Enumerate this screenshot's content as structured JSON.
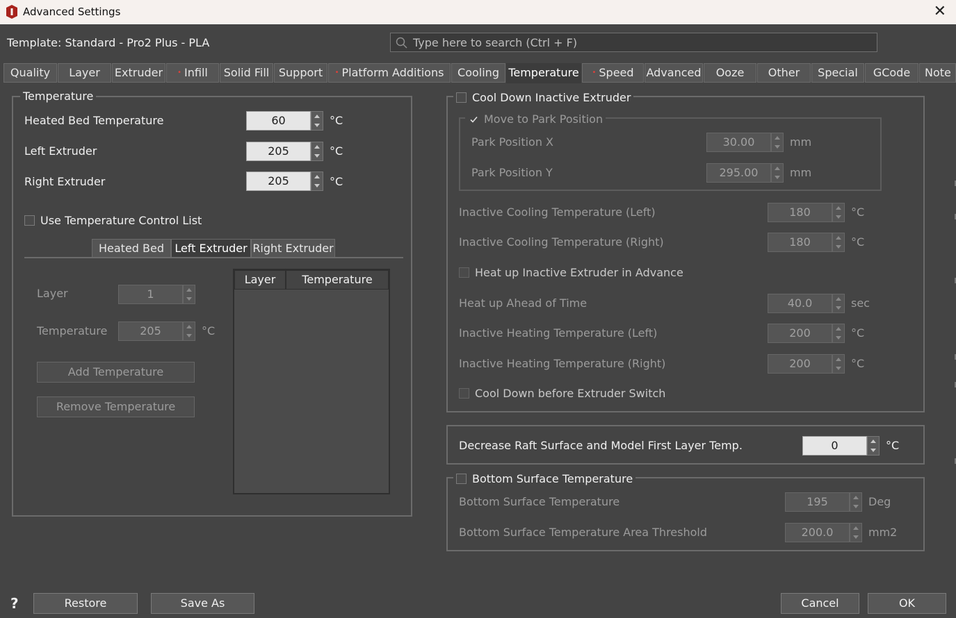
{
  "window": {
    "title": "Advanced Settings",
    "close_glyph": "✕",
    "icon": "app-logo-icon"
  },
  "template_label": "Template: Standard - Pro2 Plus - PLA",
  "search": {
    "placeholder": "Type here to search (Ctrl + F)",
    "value": ""
  },
  "tabs": [
    {
      "label": "Quality",
      "modified": false,
      "active": false
    },
    {
      "label": "Layer",
      "modified": false,
      "active": false
    },
    {
      "label": "Extruder",
      "modified": false,
      "active": false
    },
    {
      "label": "Infill",
      "modified": true,
      "active": false
    },
    {
      "label": "Solid Fill",
      "modified": false,
      "active": false
    },
    {
      "label": "Support",
      "modified": false,
      "active": false
    },
    {
      "label": "Platform Additions",
      "modified": true,
      "active": false
    },
    {
      "label": "Cooling",
      "modified": false,
      "active": false
    },
    {
      "label": "Temperature",
      "modified": false,
      "active": true
    },
    {
      "label": "Speed",
      "modified": true,
      "active": false
    },
    {
      "label": "Advanced",
      "modified": false,
      "active": false
    },
    {
      "label": "Ooze",
      "modified": false,
      "active": false
    },
    {
      "label": "Other",
      "modified": false,
      "active": false
    },
    {
      "label": "Special",
      "modified": false,
      "active": false
    },
    {
      "label": "GCode",
      "modified": false,
      "active": false
    },
    {
      "label": "Note",
      "modified": false,
      "active": false
    }
  ],
  "modified_dot": "•",
  "temperature": {
    "group_title": "Temperature",
    "heated_bed": {
      "label": "Heated Bed Temperature",
      "value": "60",
      "unit": "°C"
    },
    "left_extruder": {
      "label": "Left Extruder",
      "value": "205",
      "unit": "°C"
    },
    "right_extruder": {
      "label": "Right Extruder",
      "value": "205",
      "unit": "°C"
    },
    "use_control_list": {
      "label": "Use Temperature Control List",
      "checked": false
    },
    "subtabs": [
      "Heated Bed",
      "Left Extruder",
      "Right Extruder"
    ],
    "subtab_active": "Left Extruder",
    "layer": {
      "label": "Layer",
      "value": "1"
    },
    "temp": {
      "label": "Temperature",
      "value": "205",
      "unit": "°C"
    },
    "add_button": "Add Temperature",
    "remove_button": "Remove Temperature",
    "table_headers": [
      "Layer",
      "Temperature"
    ],
    "table_rows": []
  },
  "cooldown": {
    "title": "Cool Down Inactive Extruder",
    "checked": false,
    "park": {
      "title": "Move to Park Position",
      "checked": true,
      "x": {
        "label": "Park Position X",
        "value": "30.00",
        "unit": "mm"
      },
      "y": {
        "label": "Park Position Y",
        "value": "295.00",
        "unit": "mm"
      }
    },
    "inactive_cool_left": {
      "label": "Inactive Cooling Temperature (Left)",
      "value": "180",
      "unit": "°C"
    },
    "inactive_cool_right": {
      "label": "Inactive Cooling Temperature (Right)",
      "value": "180",
      "unit": "°C"
    },
    "heat_up_advance": {
      "label": "Heat up Inactive Extruder in Advance",
      "checked": false
    },
    "heat_ahead": {
      "label": "Heat up Ahead of Time",
      "value": "40.0",
      "unit": "sec"
    },
    "inactive_heat_left": {
      "label": "Inactive Heating Temperature (Left)",
      "value": "200",
      "unit": "°C"
    },
    "inactive_heat_right": {
      "label": "Inactive Heating Temperature (Right)",
      "value": "200",
      "unit": "°C"
    },
    "cool_before_switch": {
      "label": "Cool Down before Extruder Switch",
      "checked": false
    }
  },
  "raft": {
    "label": "Decrease Raft Surface and Model First Layer Temp.",
    "value": "0",
    "unit": "°C"
  },
  "bottom_surface": {
    "title": "Bottom Surface Temperature",
    "checked": false,
    "temperature": {
      "label": "Bottom Surface Temperature",
      "value": "195",
      "unit": "Deg"
    },
    "threshold": {
      "label": "Bottom Surface Temperature Area Threshold",
      "value": "200.0",
      "unit": "mm2"
    }
  },
  "footer": {
    "help": "?",
    "restore": "Restore",
    "save_as": "Save As",
    "cancel": "Cancel",
    "ok": "OK"
  }
}
